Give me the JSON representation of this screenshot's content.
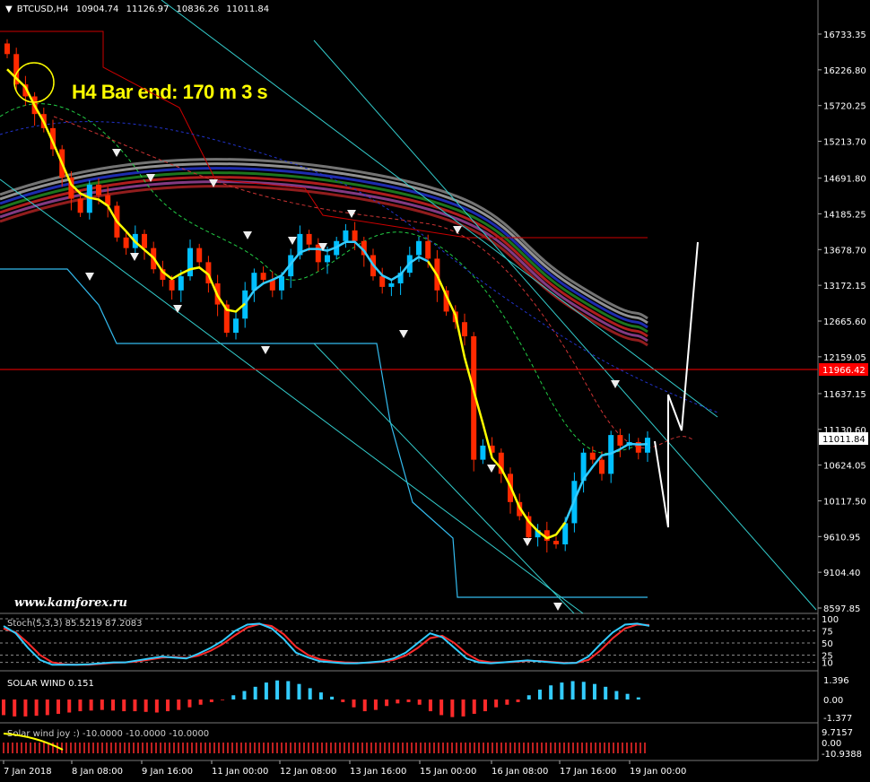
{
  "header": {
    "symbol": "BTCUSD,H4",
    "open": "10904.74",
    "high": "11126.97",
    "low": "10836.26",
    "close": "11011.84"
  },
  "overlay_text": {
    "bar_end": "H4 Bar end: 170 m 3 s",
    "watermark": "www.kamforex.ru"
  },
  "price_tags": {
    "red_line": "11966.42",
    "current": "11011.84"
  },
  "indicators": {
    "stoch_label": "Stoch(5,3,3) 85.5219 87.2083",
    "solar_label": "SOLAR WIND 0.151",
    "joy_label": "Solar wind joy :) -10.0000 -10.0000 -10.0000"
  },
  "chart_data": {
    "type": "candlestick",
    "title": "BTCUSD,H4",
    "y_ticks": [
      "16733.35",
      "16226.80",
      "15720.25",
      "15213.70",
      "14691.80",
      "14185.25",
      "13678.70",
      "13172.15",
      "12665.60",
      "12159.05",
      "11637.15",
      "11130.60",
      "10624.05",
      "10117.50",
      "9610.95",
      "9104.40",
      "8597.85"
    ],
    "ylim": [
      8597.85,
      16733.35
    ],
    "x_ticks": [
      "7 Jan 2018",
      "8 Jan 08:00",
      "9 Jan 16:00",
      "11 Jan 00:00",
      "12 Jan 08:00",
      "13 Jan 16:00",
      "15 Jan 00:00",
      "16 Jan 08:00",
      "17 Jan 16:00",
      "19 Jan 00:00"
    ],
    "close_series": [
      16450,
      16020,
      15850,
      15600,
      15400,
      15100,
      14700,
      14400,
      14200,
      14600,
      14450,
      14300,
      13850,
      13700,
      13900,
      13700,
      13400,
      13250,
      13100,
      13300,
      13700,
      13500,
      13200,
      12900,
      12500,
      12700,
      13100,
      13350,
      13250,
      13100,
      13300,
      13600,
      13900,
      13750,
      13500,
      13600,
      13800,
      13950,
      13800,
      13600,
      13300,
      13150,
      13200,
      13350,
      13600,
      13800,
      13550,
      13100,
      12800,
      12650,
      12450,
      10700,
      10900,
      10800,
      10500,
      10100,
      9900,
      9600,
      9700,
      9550,
      9500,
      9800,
      10400,
      10800,
      10700,
      10500,
      11050,
      10900,
      10950,
      10800,
      11011.84
    ],
    "stoch_ticks": [
      "100",
      "75",
      "50",
      "25",
      "10"
    ],
    "stoch_main": [
      85,
      70,
      40,
      15,
      5,
      5,
      5,
      6,
      8,
      10,
      10,
      14,
      18,
      22,
      20,
      18,
      28,
      40,
      55,
      75,
      88,
      90,
      80,
      58,
      30,
      20,
      12,
      10,
      8,
      8,
      10,
      12,
      18,
      30,
      50,
      70,
      62,
      40,
      18,
      10,
      8,
      10,
      12,
      14,
      12,
      10,
      8,
      9,
      22,
      48,
      72,
      88,
      90,
      85.5
    ],
    "stoch_signal": [
      80,
      72,
      50,
      25,
      10,
      6,
      5,
      5,
      7,
      9,
      10,
      12,
      16,
      20,
      21,
      19,
      24,
      34,
      48,
      66,
      82,
      89,
      85,
      68,
      42,
      25,
      16,
      12,
      10,
      9,
      9,
      11,
      15,
      24,
      40,
      60,
      65,
      50,
      28,
      14,
      10,
      10,
      11,
      13,
      13,
      11,
      9,
      9,
      15,
      35,
      60,
      80,
      88,
      87.2
    ],
    "solar_ticks": [
      "1.396",
      "0.00",
      "-1.377"
    ],
    "solar_values": [
      -1.2,
      -1.3,
      -1.3,
      -1.25,
      -1.2,
      -1.1,
      -1.0,
      -0.9,
      -0.85,
      -0.8,
      -0.85,
      -0.9,
      -0.9,
      -0.95,
      -1.0,
      -0.9,
      -0.8,
      -0.6,
      -0.4,
      -0.2,
      -0.05,
      0.3,
      0.6,
      0.9,
      1.2,
      1.35,
      1.3,
      1.1,
      0.8,
      0.5,
      0.2,
      -0.2,
      -0.6,
      -0.9,
      -0.8,
      -0.5,
      -0.3,
      -0.2,
      -0.4,
      -0.9,
      -1.2,
      -1.35,
      -1.3,
      -1.1,
      -0.9,
      -0.6,
      -0.4,
      -0.2,
      0.3,
      0.7,
      1.0,
      1.2,
      1.3,
      1.25,
      1.1,
      0.9,
      0.6,
      0.4,
      0.15
    ],
    "joy_ticks": [
      "9.7157",
      "0.00",
      "-10.9388"
    ],
    "joy_values": [
      -10.0,
      -10.0,
      -10.0
    ]
  },
  "colors": {
    "bull": "#00bfff",
    "bear": "#ff2a00",
    "yellow": "#ffff00",
    "aqua_line": "#33ccff",
    "red_line": "#ff0000"
  }
}
